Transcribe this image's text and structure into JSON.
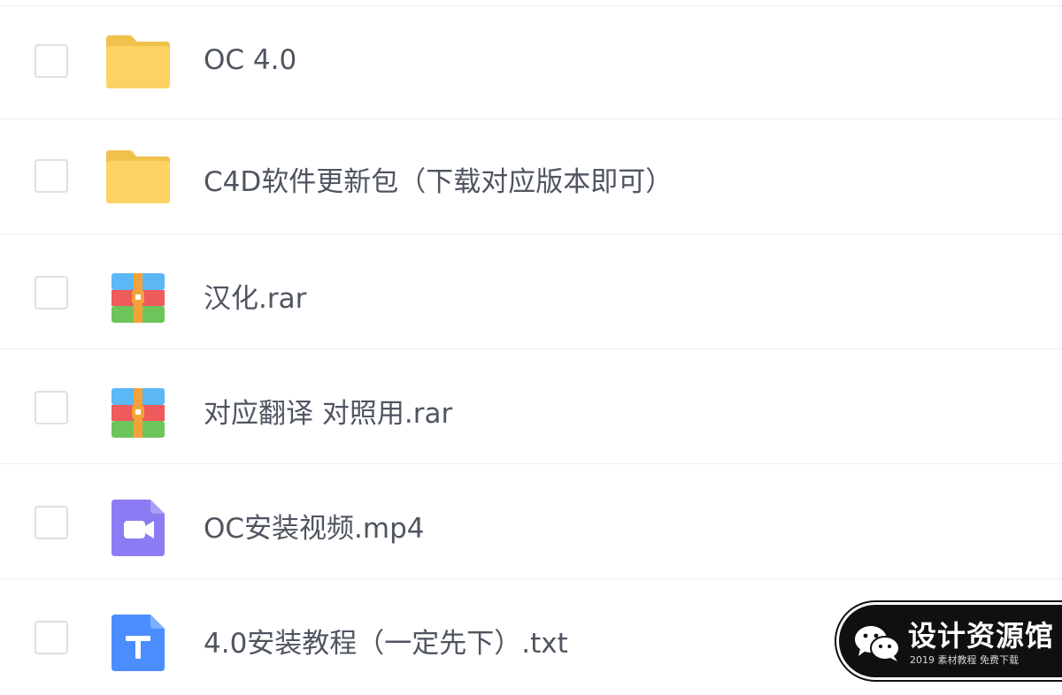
{
  "files": [
    {
      "name": "OC 4.0",
      "type": "folder",
      "icon": "folder-icon"
    },
    {
      "name": "C4D软件更新包（下载对应版本即可）",
      "type": "folder",
      "icon": "folder-icon"
    },
    {
      "name": "汉化.rar",
      "type": "archive",
      "icon": "archive-icon"
    },
    {
      "name": "对应翻译 对照用.rar",
      "type": "archive",
      "icon": "archive-icon"
    },
    {
      "name": "OC安装视频.mp4",
      "type": "video",
      "icon": "video-icon"
    },
    {
      "name": "4.0安装教程（一定先下）.txt",
      "type": "text",
      "icon": "text-file-icon"
    }
  ],
  "watermark": {
    "title": "设计资源馆",
    "subtitle": "2019 素材教程 免费下载",
    "icon": "wechat-icon"
  },
  "colors": {
    "folder": "#fcd362",
    "video": "#8b7cf3",
    "text": "#4a8dff",
    "text_color": "#4f5560",
    "divider": "#eceef2"
  }
}
